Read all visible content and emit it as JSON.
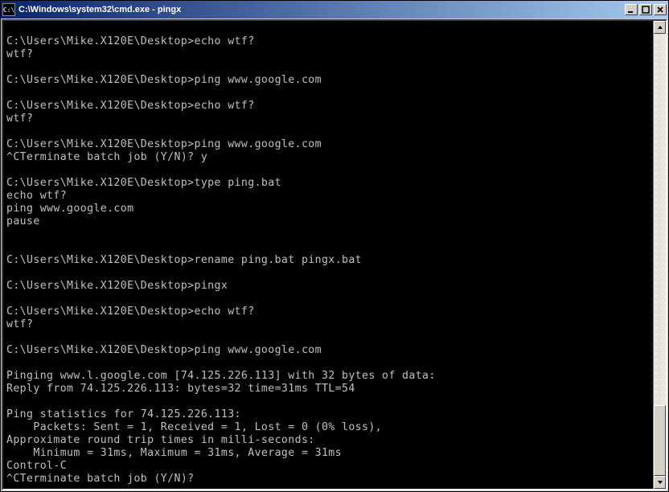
{
  "window": {
    "title": "C:\\Windows\\system32\\cmd.exe - pingx",
    "icon_label": "C:\\"
  },
  "scrollbar": {
    "thumb_top_pct": 84,
    "thumb_height_pct": 16
  },
  "terminal": {
    "lines": [
      "",
      "C:\\Users\\Mike.X120E\\Desktop>echo wtf?",
      "wtf?",
      "",
      "C:\\Users\\Mike.X120E\\Desktop>ping www.google.com",
      "",
      "C:\\Users\\Mike.X120E\\Desktop>echo wtf?",
      "wtf?",
      "",
      "C:\\Users\\Mike.X120E\\Desktop>ping www.google.com",
      "^CTerminate batch job (Y/N)? y",
      "",
      "C:\\Users\\Mike.X120E\\Desktop>type ping.bat",
      "echo wtf?",
      "ping www.google.com",
      "pause",
      "",
      "",
      "C:\\Users\\Mike.X120E\\Desktop>rename ping.bat pingx.bat",
      "",
      "C:\\Users\\Mike.X120E\\Desktop>pingx",
      "",
      "C:\\Users\\Mike.X120E\\Desktop>echo wtf?",
      "wtf?",
      "",
      "C:\\Users\\Mike.X120E\\Desktop>ping www.google.com",
      "",
      "Pinging www.l.google.com [74.125.226.113] with 32 bytes of data:",
      "Reply from 74.125.226.113: bytes=32 time=31ms TTL=54",
      "",
      "Ping statistics for 74.125.226.113:",
      "    Packets: Sent = 1, Received = 1, Lost = 0 (0% loss),",
      "Approximate round trip times in milli-seconds:",
      "    Minimum = 31ms, Maximum = 31ms, Average = 31ms",
      "Control-C",
      "^CTerminate batch job (Y/N)?"
    ]
  }
}
